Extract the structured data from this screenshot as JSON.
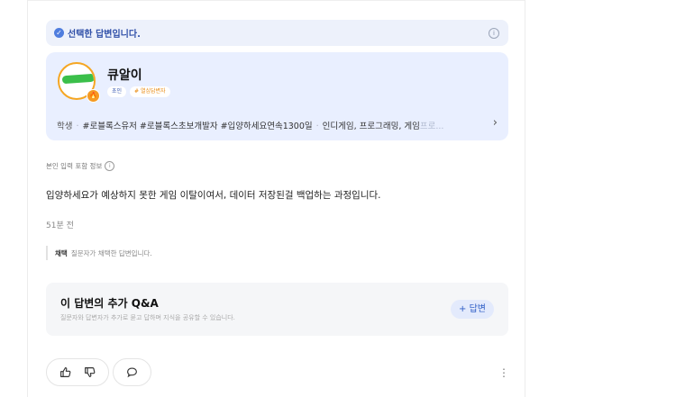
{
  "selected": {
    "text": "선택한 답변입니다.",
    "check_icon": "✓",
    "info_icon": "i"
  },
  "profile": {
    "username": "큐알이",
    "tags": [
      "초인",
      "# 열심답변자"
    ],
    "job": "학생",
    "bio_main": "#로블록스유저 #로블록스초보개발자 #입양하세요연속1300일",
    "bio_interests": "인디게임, 프로그래밍, 게임",
    "bio_fade": "프로...",
    "badge_icon": "🔥"
  },
  "meta": {
    "label": "본인 입력 포함 정보",
    "info_icon": "i"
  },
  "answer": {
    "text": "입양하세요가 예상하지 못한 게임 이탈이여서, 데이터 저장된걸 백업하는 과정입니다."
  },
  "time_ago": "51분 전",
  "adopt": {
    "label": "채택",
    "desc": "질문자가 채택한 답변입니다."
  },
  "qa": {
    "title": "이 답변의 추가 Q&A",
    "desc": "질문자와 답변자가 추가로 묻고 답하며 지식을 공유할 수 있습니다.",
    "button_label": "+ 답변"
  },
  "more_icon": "⋮",
  "colors": {
    "accent": "#2f5ec6",
    "profile_bg": "#e9efff",
    "banner_bg": "#edf1fb"
  }
}
